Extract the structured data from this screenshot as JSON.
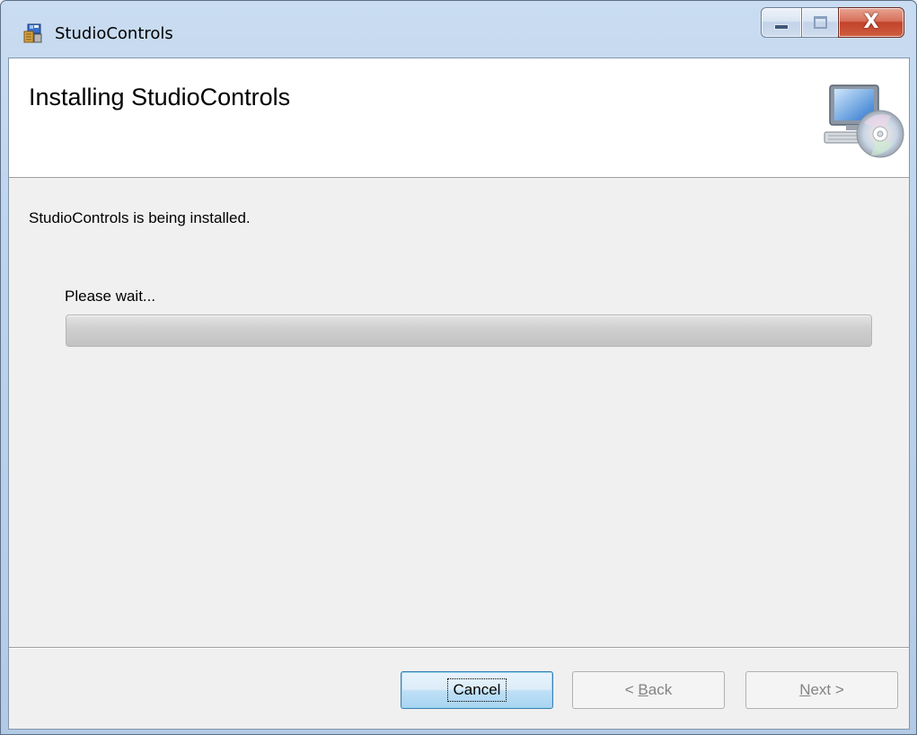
{
  "window": {
    "title": "StudioControls",
    "icon": "installer-package-icon",
    "controls": {
      "minimize": "minimize-icon",
      "maximize": "maximize-icon",
      "close_glyph": "X"
    }
  },
  "banner": {
    "title": "Installing StudioControls",
    "icon": "computer-cd-icon"
  },
  "body": {
    "status_text": "StudioControls is being installed.",
    "progress_label": "Please wait...",
    "progress_value": 0
  },
  "buttons": {
    "cancel": {
      "label": "Cancel",
      "enabled": true
    },
    "back": {
      "label_prefix": "< ",
      "mnemonic": "B",
      "label_rest": "ack",
      "enabled": false
    },
    "next": {
      "mnemonic": "N",
      "label_rest": "ext",
      "label_suffix": " >",
      "enabled": false
    }
  },
  "colors": {
    "titlebar": "#bcd2ec",
    "client_background": "#f0f0f0",
    "banner_background": "#ffffff",
    "close_button": "#c2432b",
    "default_button_border": "#3c7fb1"
  }
}
